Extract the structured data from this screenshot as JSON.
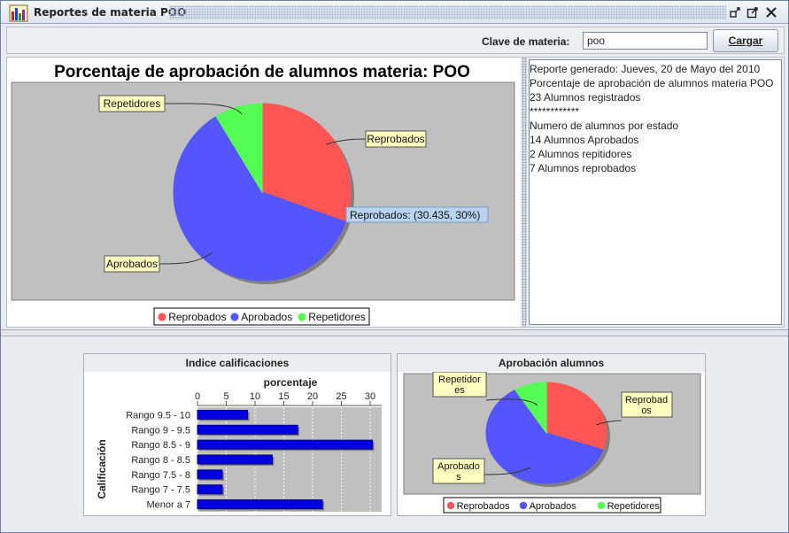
{
  "window": {
    "title": "Reportes de materia POO"
  },
  "toolbar": {
    "clave_label": "Clave de materia:",
    "clave_value": "poo",
    "cargar_label": "Cargar"
  },
  "main_chart": {
    "title": "Porcentaje de aprobación de alumnos materia: POO",
    "tooltip": "Reprobados: (30.435, 30%)",
    "labels": {
      "repetidores": "Repetidores",
      "reprobados": "Reprobados",
      "aprobados": "Aprobados"
    }
  },
  "report": {
    "lines": [
      "Reporte generado: Jueves, 20 de Mayo del 2010",
      "Porcentaje de aprobación de alumnos materia POO",
      "23 Alumnos registrados",
      "************",
      "Numero de alumnos por estado",
      "14 Alumnos Aprobados",
      "2 Alumnos repitidores",
      "7 Alumnos reprobados"
    ]
  },
  "bar_panel": {
    "title": "Indice calificaciones",
    "xlabel": "porcentaje",
    "ylabel": "Calificación"
  },
  "small_pie_panel": {
    "title": "Aprobación alumnos",
    "labels": {
      "repetidores": [
        "Repetidor",
        "es"
      ],
      "reprobados": [
        "Reprobad",
        "os"
      ],
      "aprobados": [
        "Aprobado",
        "s"
      ]
    }
  },
  "colors": {
    "reprobados": "#ff5555",
    "aprobados": "#5555ff",
    "repetidores": "#55ff55",
    "plot_bg": "#c0c0c0",
    "bar": "#0000e0"
  },
  "chart_data": [
    {
      "type": "pie",
      "title": "Porcentaje de aprobación de alumnos materia: POO",
      "categories": [
        "Reprobados",
        "Aprobados",
        "Repetidores"
      ],
      "values": [
        7,
        14,
        2
      ],
      "legend": "bottom"
    },
    {
      "type": "bar",
      "orientation": "horizontal",
      "title": "Indice calificaciones",
      "xlabel": "porcentaje",
      "ylabel": "Calificación",
      "categories": [
        "Rango 9.5 - 10",
        "Rango 9 - 9.5",
        "Rango 8.5 - 9",
        "Rango 8 - 8.5",
        "Rango 7.5 - 8",
        "Rango 7 - 7.5",
        "Menor a 7"
      ],
      "values": [
        8.7,
        17.4,
        30.4,
        13.0,
        4.3,
        4.3,
        21.7
      ],
      "xlim": [
        0,
        32
      ],
      "ticks": [
        0,
        5,
        10,
        15,
        20,
        25,
        30
      ],
      "grid": true
    },
    {
      "type": "pie",
      "title": "Aprobación alumnos",
      "categories": [
        "Reprobados",
        "Aprobados",
        "Repetidores"
      ],
      "values": [
        7,
        14,
        2
      ],
      "legend": "bottom"
    }
  ]
}
